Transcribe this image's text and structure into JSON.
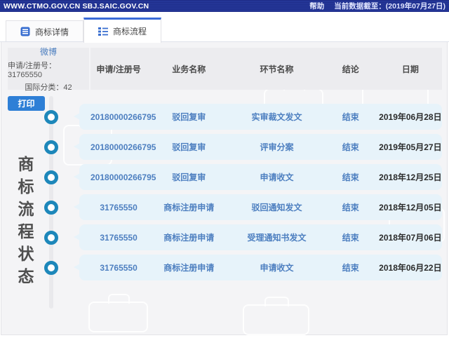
{
  "topbar": {
    "domains": "WWW.CTMO.GOV.CN SBJ.SAIC.GOV.CN",
    "help": "帮助",
    "data_cutoff": "当前数据截至：(2019年07月27日)"
  },
  "tabs": [
    {
      "label": "商标详情",
      "active": false
    },
    {
      "label": "商标流程",
      "active": true
    }
  ],
  "info": {
    "trademark_name": "微博",
    "registration": "申请/注册号：31765550",
    "intl_class": "国际分类：42"
  },
  "print_label": "打印",
  "vertical_title": "商标流程状态",
  "table": {
    "headers": [
      "申请/注册号",
      "业务名称",
      "环节名称",
      "结论",
      "日期"
    ],
    "rows": [
      [
        "20180000266795",
        "驳回复审",
        "实审裁文发文",
        "结束",
        "2019年06月28日"
      ],
      [
        "20180000266795",
        "驳回复审",
        "评审分案",
        "结束",
        "2019年05月27日"
      ],
      [
        "20180000266795",
        "驳回复审",
        "申请收文",
        "结束",
        "2018年12月25日"
      ],
      [
        "31765550",
        "商标注册申请",
        "驳回通知发文",
        "结束",
        "2018年12月05日"
      ],
      [
        "31765550",
        "商标注册申请",
        "受理通知书发文",
        "结束",
        "2018年07月06日"
      ],
      [
        "31765550",
        "商标注册申请",
        "申请收文",
        "结束",
        "2018年06月22日"
      ]
    ]
  },
  "colors": {
    "topbar_navy": "#20308e",
    "tab_active_accent": "#3a6bd8",
    "link_blue": "#4d7fc0",
    "bubble_bg": "#e7f3fa",
    "timeline_circle": "#1d87ba",
    "print_button": "#2e7fd6",
    "band_gray": "#ececef",
    "content_bg": "#f4f4f6"
  }
}
